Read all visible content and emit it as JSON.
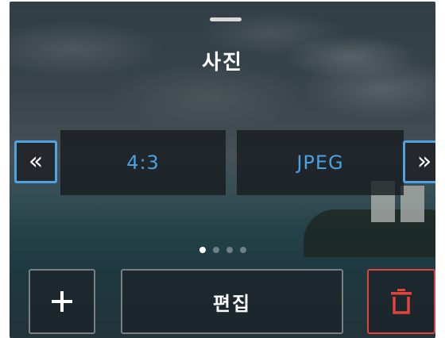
{
  "panel": {
    "title": "사진"
  },
  "options": {
    "items": [
      {
        "label": "4:3"
      },
      {
        "label": "JPEG"
      }
    ],
    "prev_icon": "double-chevron-left-icon",
    "next_icon": "double-chevron-right-icon",
    "page_count": 4,
    "active_page": 1
  },
  "actions": {
    "add_icon": "plus-icon",
    "edit_label": "편집",
    "delete_icon": "trash-icon"
  },
  "colors": {
    "accent": "#4ea3e0",
    "option_text": "#4aa0e0",
    "delete": "#e0443c"
  }
}
